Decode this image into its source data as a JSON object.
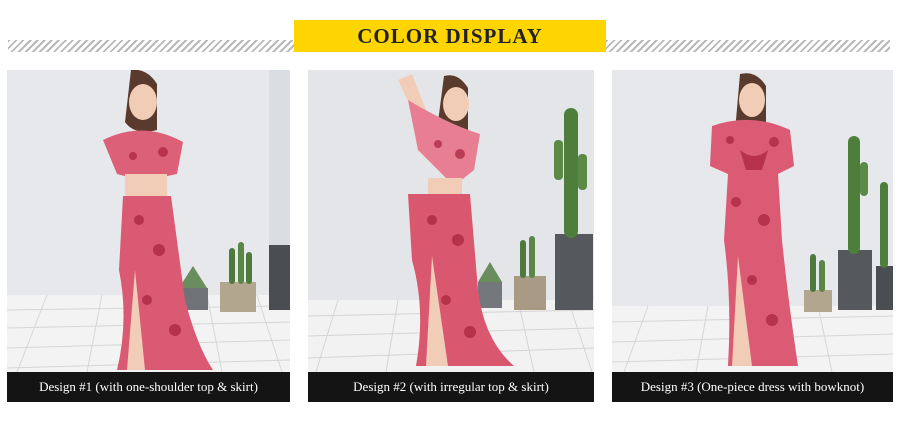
{
  "header": {
    "title": "COLOR DISPLAY",
    "accent_color": "#ffd500"
  },
  "panels": [
    {
      "caption": "Design #1 (with one-shoulder top & skirt)",
      "image": "model-photo-one-shoulder-top-skirt"
    },
    {
      "caption": "Design #2 (with irregular top & skirt)",
      "image": "model-photo-irregular-top-skirt"
    },
    {
      "caption": "Design #3 (One-piece dress with bowknot)",
      "image": "model-photo-one-piece-dress"
    }
  ],
  "colors": {
    "fabric": "#dc6078",
    "caption_bg": "#141414",
    "wall": "#e9ebee",
    "floor": "#f2f2f2"
  }
}
